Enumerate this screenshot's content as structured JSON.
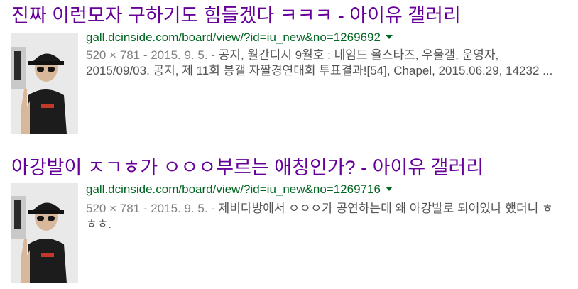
{
  "results": [
    {
      "title": "진짜 이런모자 구하기도 힘들겠다 ㅋㅋㅋ - 아이유 갤러리",
      "url": "gall.dcinside.com/board/view/?id=iu_new&no=1269692",
      "meta": "520 × 781 - 2015. 9. 5. - ",
      "snippet": "공지, 월간디시 9월호 : 네임드 올스타즈, 우울갤, 운영자, 2015/09/03. 공지, 제 11회 봉갤 자짤경연대회 투표결과![54], Chapel, 2015.06.29, 14232 ...",
      "thumbnail_icon": "photo-thumbnail-icon"
    },
    {
      "title": "아강발이 ㅈㄱㅎ가 ㅇㅇㅇ부르는 애칭인가? - 아이유 갤러리",
      "url": "gall.dcinside.com/board/view/?id=iu_new&no=1269716",
      "meta": "520 × 781 - 2015. 9. 5. - ",
      "snippet": "제비다방에서 ㅇㅇㅇ가 공연하는데 왜 아강발로 되어있나 했더니 ㅎㅎㅎ.",
      "thumbnail_icon": "photo-thumbnail-icon"
    }
  ],
  "colors": {
    "title": "#660099",
    "url": "#006621",
    "snippet": "#545454"
  }
}
